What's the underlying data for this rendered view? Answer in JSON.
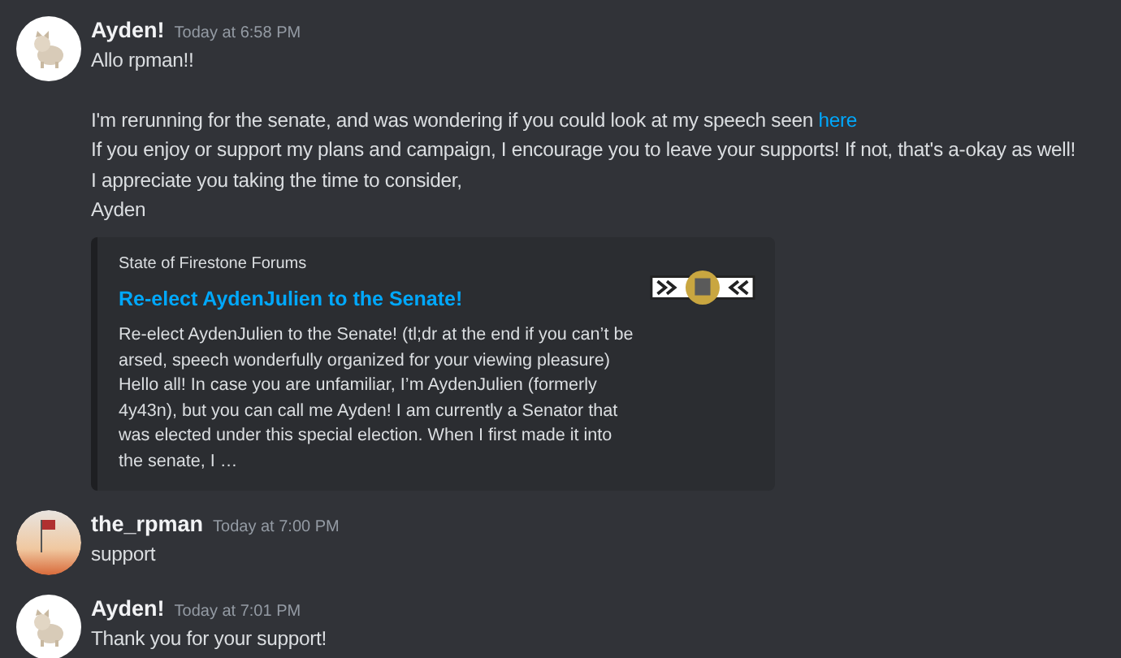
{
  "messages": [
    {
      "author": "Ayden!",
      "time": "Today at 6:58 PM",
      "kind": "cat",
      "blocks": [
        [
          {
            "text": "Allo rpman!!"
          }
        ],
        [
          {
            "text": "I'm rerunning for the senate, and was wondering if you could look at my speech seen ",
            "link": "here"
          },
          {
            "text": "If you enjoy or support my plans and campaign, I encourage you to leave your supports! If not, that's a-okay as well!"
          },
          {
            "text": "I appreciate you taking the time to consider,"
          },
          {
            "text": "Ayden"
          }
        ]
      ],
      "embed": {
        "provider": "State of Firestone Forums",
        "title": "Re-elect AydenJulien to the Senate!",
        "description": "Re-elect AydenJulien to the Senate! (tl;dr at the end if you can’t be arsed, speech wonderfully organized for your viewing pleasure) Hello all! In case you are unfamiliar, I’m AydenJulien (formerly 4y43n), but you can call me Ayden! I am currently a Senator that was elected under this special election. When I first made it into the senate, I …"
      }
    },
    {
      "author": "the_rpman",
      "time": "Today at 7:00 PM",
      "kind": "flag",
      "blocks": [
        [
          {
            "text": "support"
          }
        ]
      ]
    },
    {
      "author": "Ayden!",
      "time": "Today at 7:01 PM",
      "kind": "cat",
      "blocks": [
        [
          {
            "text": "Thank you for your support!"
          }
        ]
      ]
    }
  ]
}
